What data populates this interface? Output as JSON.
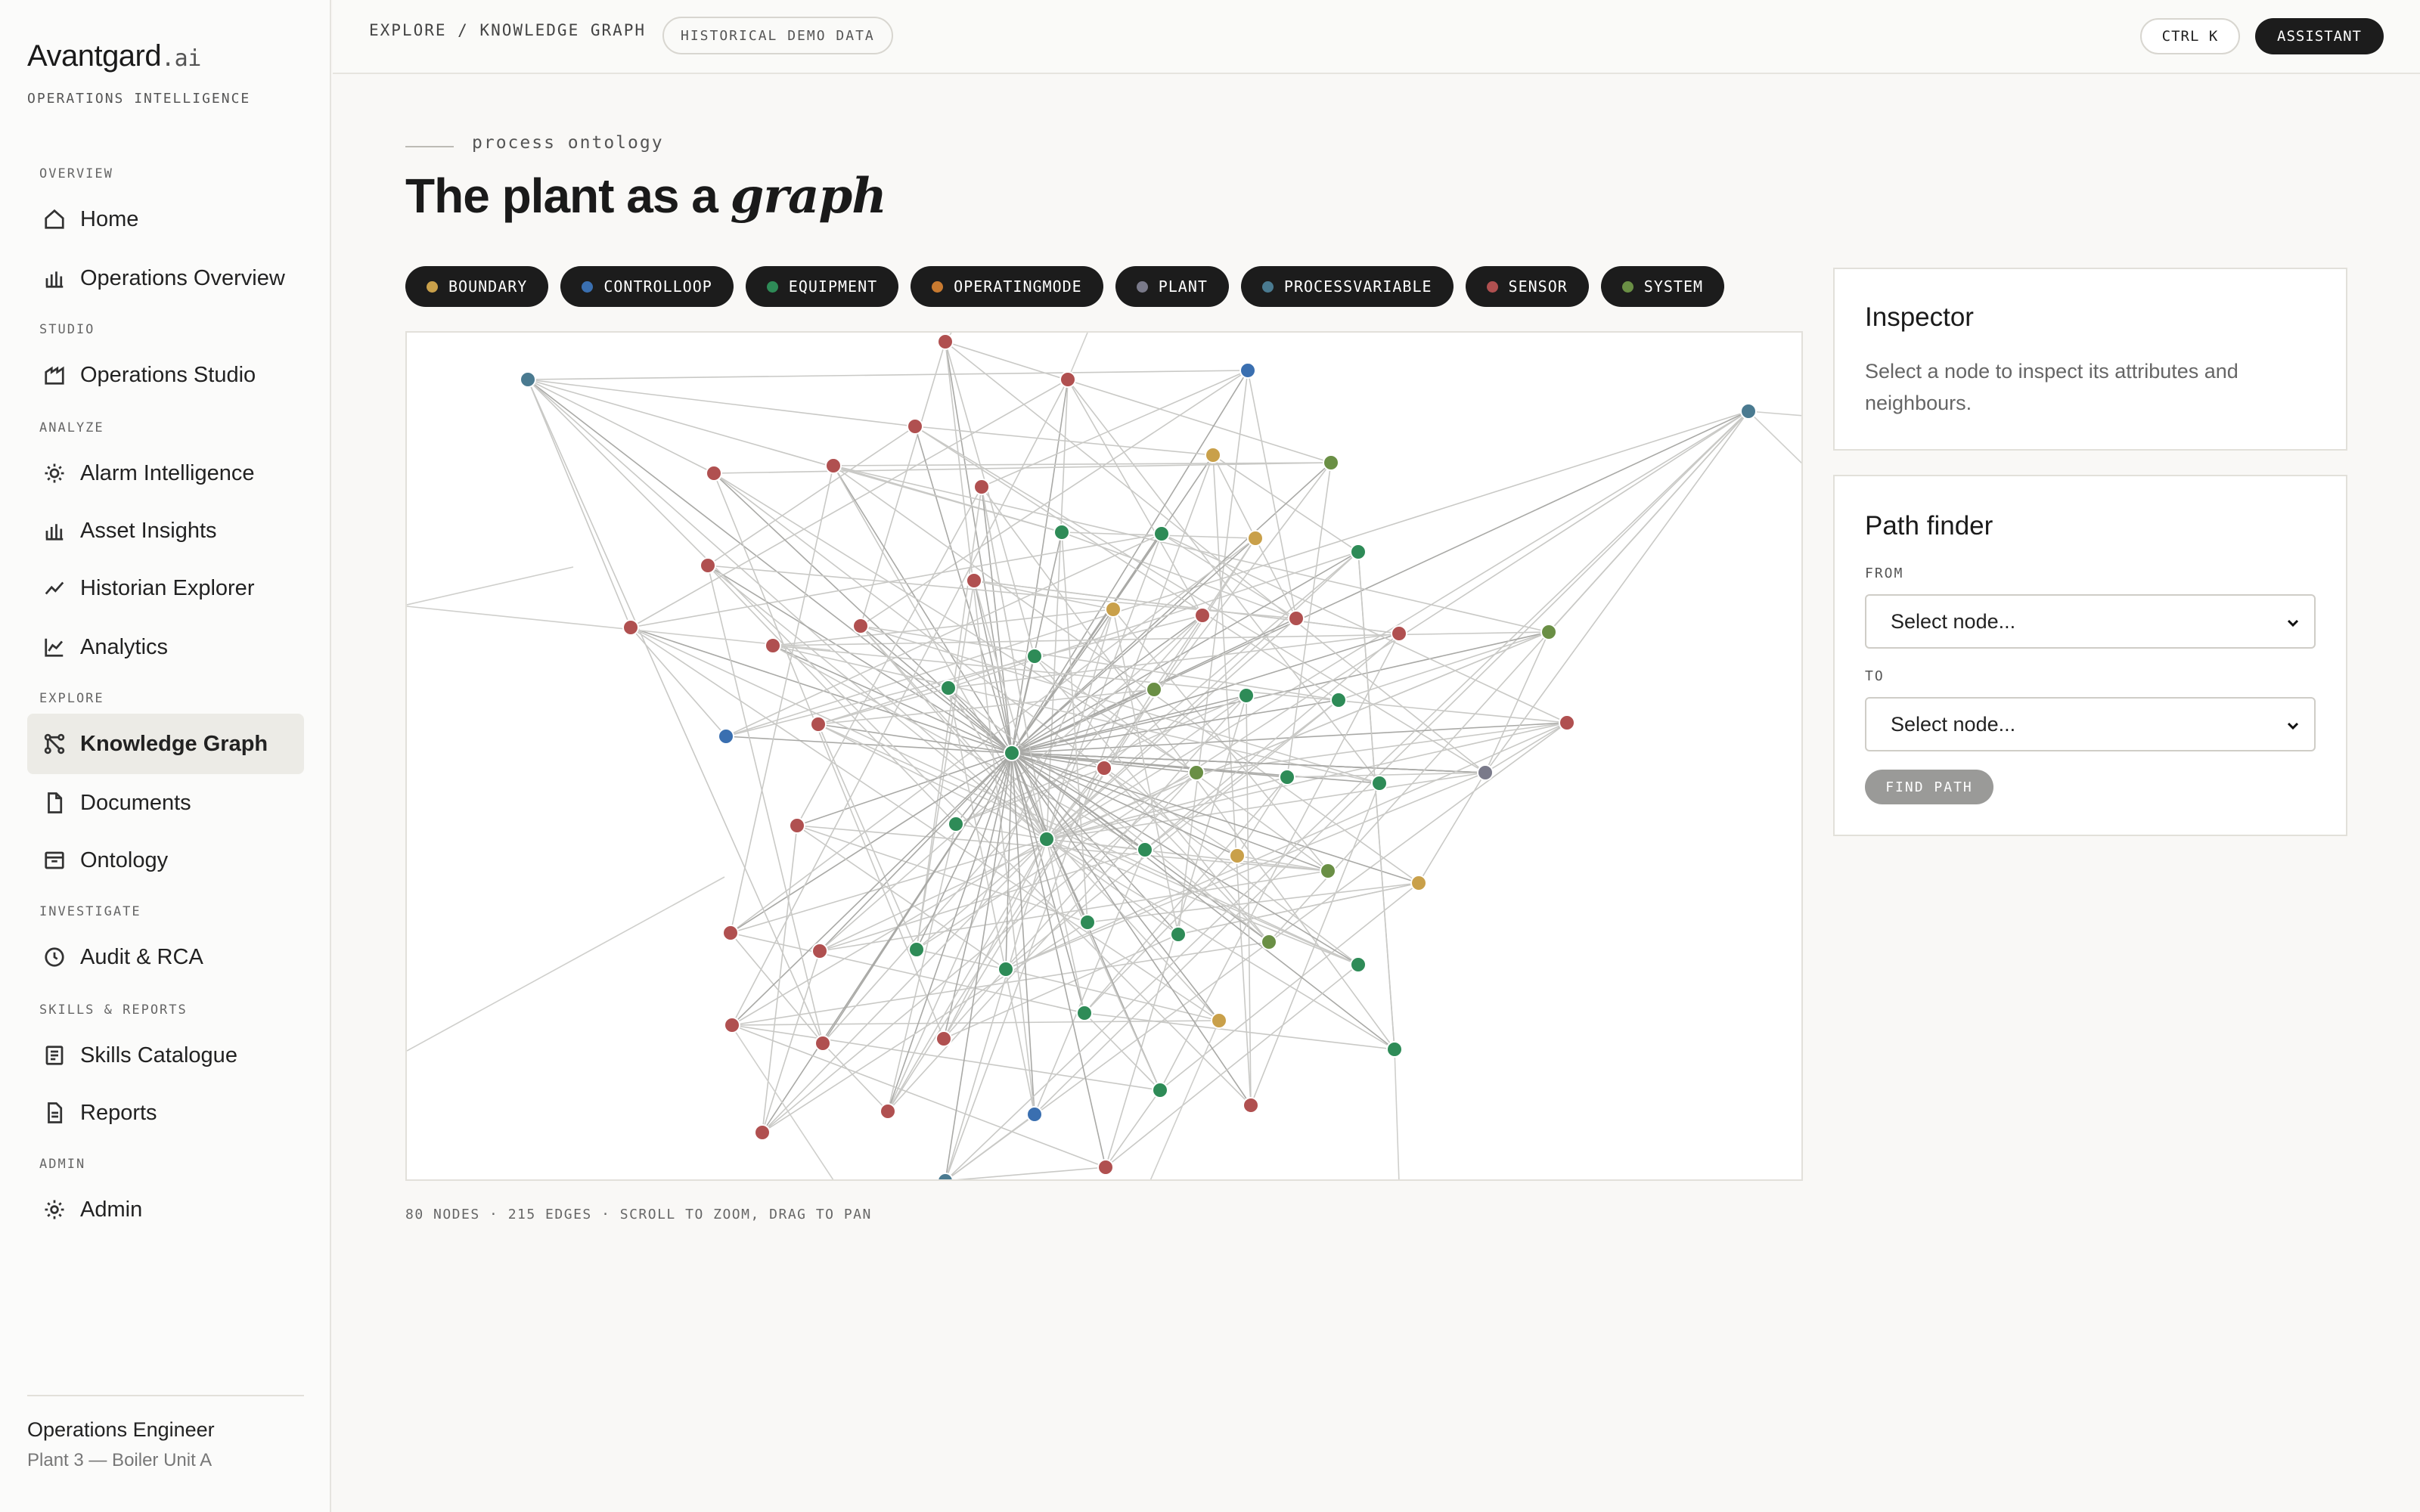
{
  "brand": {
    "name": "Avantgard",
    "suffix": ".ai",
    "subtitle": "OPERATIONS INTELLIGENCE"
  },
  "sidebar": {
    "sections": [
      {
        "label": "OVERVIEW",
        "items": [
          {
            "label": "Home",
            "icon": "home-icon"
          },
          {
            "label": "Operations Overview",
            "icon": "bar-chart-icon"
          }
        ]
      },
      {
        "label": "STUDIO",
        "items": [
          {
            "label": "Operations Studio",
            "icon": "factory-icon"
          }
        ]
      },
      {
        "label": "ANALYZE",
        "items": [
          {
            "label": "Alarm Intelligence",
            "icon": "sun-icon"
          },
          {
            "label": "Asset Insights",
            "icon": "bar-chart-icon"
          },
          {
            "label": "Historian Explorer",
            "icon": "trend-icon"
          },
          {
            "label": "Analytics",
            "icon": "line-chart-icon"
          }
        ]
      },
      {
        "label": "EXPLORE",
        "items": [
          {
            "label": "Knowledge Graph",
            "icon": "graph-icon",
            "active": true
          },
          {
            "label": "Documents",
            "icon": "document-icon"
          },
          {
            "label": "Ontology",
            "icon": "archive-icon"
          }
        ]
      },
      {
        "label": "INVESTIGATE",
        "items": [
          {
            "label": "Audit & RCA",
            "icon": "clock-icon"
          }
        ]
      },
      {
        "label": "SKILLS & REPORTS",
        "items": [
          {
            "label": "Skills Catalogue",
            "icon": "list-icon"
          },
          {
            "label": "Reports",
            "icon": "report-icon"
          }
        ]
      },
      {
        "label": "ADMIN",
        "items": [
          {
            "label": "Admin",
            "icon": "gear-icon"
          }
        ]
      }
    ],
    "user": {
      "role": "Operations Engineer",
      "plant": "Plant 3 — Boiler Unit A"
    }
  },
  "topbar": {
    "breadcrumb": "EXPLORE / KNOWLEDGE GRAPH",
    "badge": "HISTORICAL DEMO DATA",
    "shortcut_label": "CTRL K",
    "assistant_label": "ASSISTANT"
  },
  "page": {
    "eyebrow": "process ontology",
    "title_plain": "The plant as a ",
    "title_em": "graph"
  },
  "legend": [
    {
      "label": "BOUNDARY",
      "color": "#c9a04a"
    },
    {
      "label": "CONTROLLOOP",
      "color": "#3a6fb0"
    },
    {
      "label": "EQUIPMENT",
      "color": "#2e8b57"
    },
    {
      "label": "OPERATINGMODE",
      "color": "#c87a30"
    },
    {
      "label": "PLANT",
      "color": "#7a7a8a"
    },
    {
      "label": "PROCESSVARIABLE",
      "color": "#4a7a90"
    },
    {
      "label": "SENSOR",
      "color": "#b05050"
    },
    {
      "label": "SYSTEM",
      "color": "#6a8f45"
    }
  ],
  "graph": {
    "status": "80 NODES · 215 EDGES · SCROLL TO ZOOM, DRAG TO PAN"
  },
  "inspector": {
    "title": "Inspector",
    "hint": "Select a node to inspect its attributes and neighbours."
  },
  "pathfinder": {
    "title": "Path finder",
    "from_label": "FROM",
    "to_label": "TO",
    "from_value": "Select node...",
    "to_value": "Select node...",
    "button_label": "FIND PATH"
  }
}
